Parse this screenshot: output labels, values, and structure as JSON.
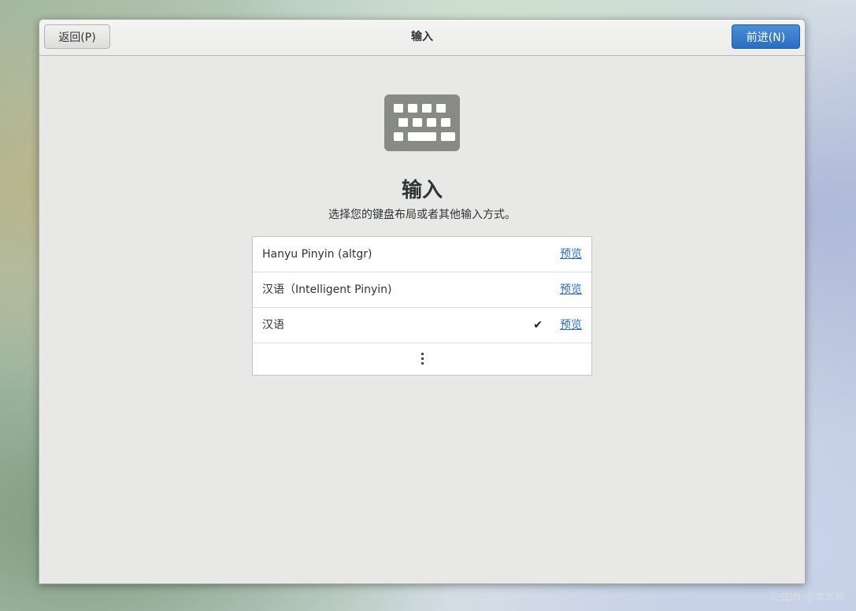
{
  "header": {
    "back_label": "返回(P)",
    "title": "输入",
    "next_label": "前进(N)"
  },
  "main": {
    "icon": "keyboard-icon",
    "heading": "输入",
    "subtitle": "选择您的键盘布局或者其他输入方式。",
    "input_sources": [
      {
        "name": "Hanyu Pinyin (altgr)",
        "selected": false,
        "preview_label": "预览"
      },
      {
        "name": "汉语（Intelligent Pinyin)",
        "selected": false,
        "preview_label": "预览"
      },
      {
        "name": "汉语",
        "selected": true,
        "check_glyph": "✔",
        "preview_label": "预览"
      }
    ],
    "more_icon": "vertical-ellipsis-icon"
  },
  "watermark": "CSDN @李本帅",
  "colors": {
    "accent": "#2a6dc1",
    "window_bg": "#e8e8e7",
    "icon_gray": "#888a85"
  }
}
